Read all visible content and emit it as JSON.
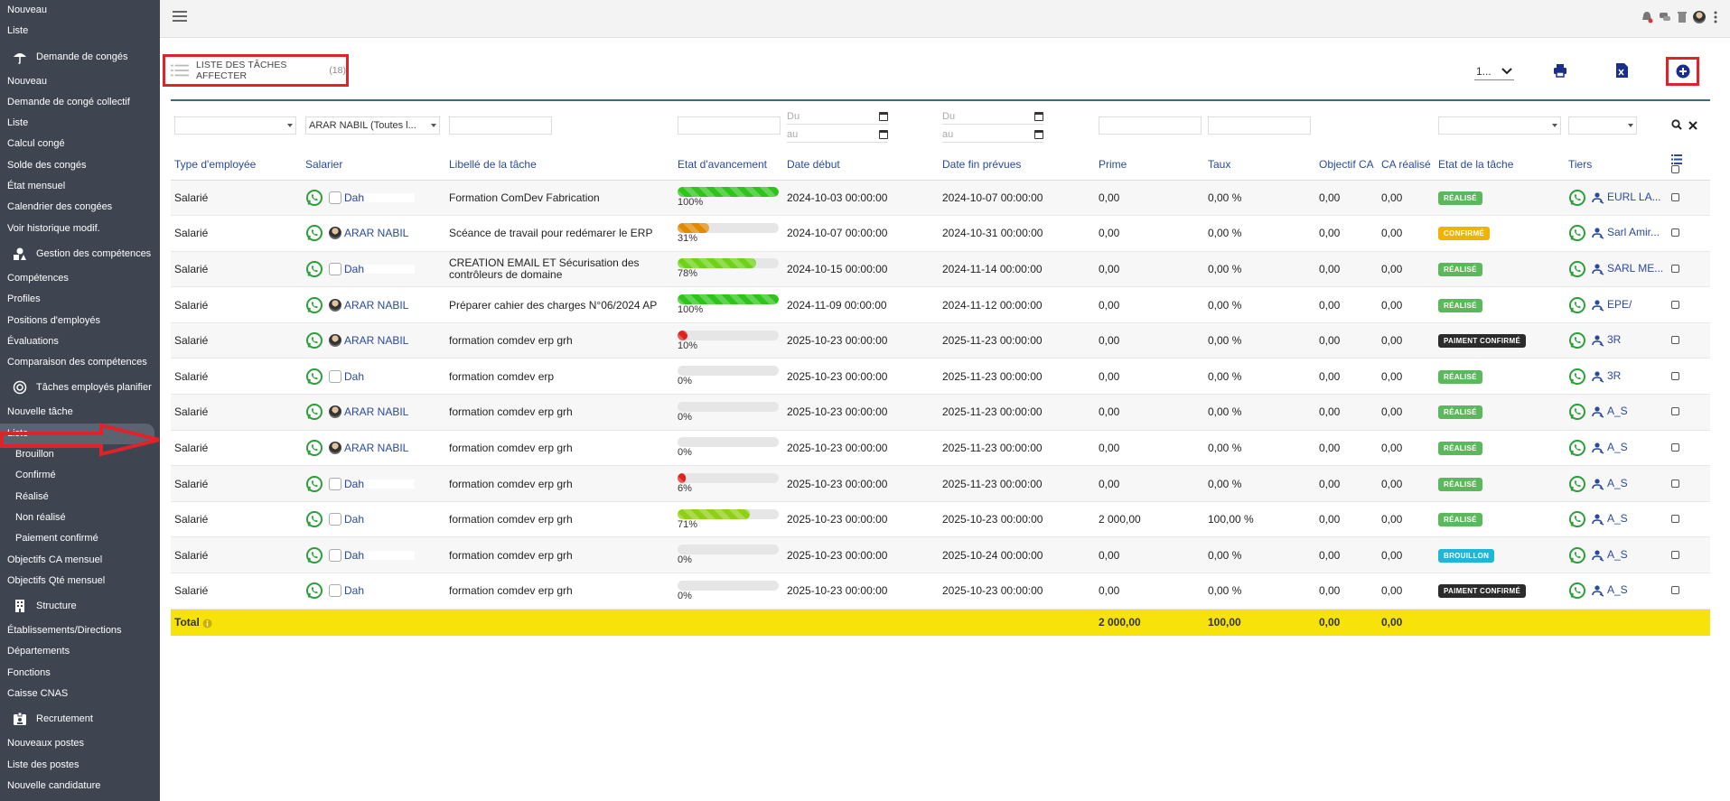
{
  "sidebar": {
    "items": [
      {
        "type": "item",
        "label": "Nouveau"
      },
      {
        "type": "item",
        "label": "Liste"
      },
      {
        "type": "group",
        "label": "Demande de congés",
        "icon": "umbrella-icon"
      },
      {
        "type": "item",
        "label": "Nouveau"
      },
      {
        "type": "item",
        "label": "Demande de congé collectif"
      },
      {
        "type": "item",
        "label": "Liste"
      },
      {
        "type": "item",
        "label": "Calcul congé"
      },
      {
        "type": "item",
        "label": "Solde des congés"
      },
      {
        "type": "item",
        "label": "État mensuel"
      },
      {
        "type": "item",
        "label": "Calendrier des congées"
      },
      {
        "type": "item",
        "label": "Voir historique modif."
      },
      {
        "type": "group",
        "label": "Gestion des compétences",
        "icon": "shapes-icon"
      },
      {
        "type": "item",
        "label": "Compétences"
      },
      {
        "type": "item",
        "label": "Profiles"
      },
      {
        "type": "item",
        "label": "Positions d'employés"
      },
      {
        "type": "item",
        "label": "Évaluations"
      },
      {
        "type": "item",
        "label": "Comparaison des compétences"
      },
      {
        "type": "group",
        "label": "Tâches employés planifier",
        "icon": "target-icon"
      },
      {
        "type": "item",
        "label": "Nouvelle tâche"
      },
      {
        "type": "item",
        "label": "Liste",
        "active": true
      },
      {
        "type": "sub",
        "label": "Brouillon"
      },
      {
        "type": "sub",
        "label": "Confirmé"
      },
      {
        "type": "sub",
        "label": "Réalisé"
      },
      {
        "type": "sub",
        "label": "Non réalisé"
      },
      {
        "type": "sub",
        "label": "Paiement confirmé"
      },
      {
        "type": "item",
        "label": "Objectifs CA mensuel"
      },
      {
        "type": "item",
        "label": "Objectifs Qté mensuel"
      },
      {
        "type": "group",
        "label": "Structure",
        "icon": "building-icon"
      },
      {
        "type": "item",
        "label": "Établissements/Directions"
      },
      {
        "type": "item",
        "label": "Départements"
      },
      {
        "type": "item",
        "label": "Fonctions"
      },
      {
        "type": "item",
        "label": "Caisse CNAS"
      },
      {
        "type": "group",
        "label": "Recrutement",
        "icon": "badge-icon"
      },
      {
        "type": "item",
        "label": "Nouveaux postes"
      },
      {
        "type": "item",
        "label": "Liste des postes"
      },
      {
        "type": "item",
        "label": "Nouvelle candidature"
      }
    ]
  },
  "header": {
    "title": "LISTE DES TÂCHES AFFECTER",
    "count": "(18)",
    "pager_value": "1..."
  },
  "filters": {
    "salarier": "ARAR NABIL (Toutes l...",
    "du": "Du",
    "au": "au"
  },
  "columns": [
    "Type d'employée",
    "Salarier",
    "Libellé de la tâche",
    "Etat d'avancement",
    "Date début",
    "Date fin prévues",
    "Prime",
    "Taux",
    "Objectif CA",
    "CA réalisé",
    "Etat de la tâche",
    "Tiers"
  ],
  "colors": {
    "realise": "#5cb85c",
    "confirme": "#f0b400",
    "paiement": "#2b2b2b",
    "brouillon": "#1fb6d8",
    "progress_full": "#2ec41a",
    "progress_mid": "#e08a00",
    "progress_low": "#e0231a",
    "progress_lime": "#8fd010"
  },
  "rows": [
    {
      "type": "Salarié",
      "employee": "Dah",
      "avatar": "blank",
      "task": "Formation ComDev Fabrication",
      "progress": 100,
      "progress_label": "100%",
      "progress_color": "#2ec41a",
      "start": "2024-10-03 00:00:00",
      "end": "2024-10-07 00:00:00",
      "prime": "0,00",
      "taux": "0,00 %",
      "objectif": "0,00",
      "ca": "0,00",
      "status": "RÉALISÉ",
      "status_color": "#5cb85c",
      "tiers": "EURL LA..."
    },
    {
      "type": "Salarié",
      "employee": "ARAR NABIL",
      "avatar": "photo",
      "task": "Scéance de travail pour redémarer le ERP",
      "progress": 31,
      "progress_label": "31%",
      "progress_color": "#e08a00",
      "start": "2024-10-07 00:00:00",
      "end": "2024-10-31 00:00:00",
      "prime": "0,00",
      "taux": "0,00 %",
      "objectif": "0,00",
      "ca": "0,00",
      "status": "CONFIRMÉ",
      "status_color": "#f0b400",
      "tiers": "Sarl Amir..."
    },
    {
      "type": "Salarié",
      "employee": "Dah",
      "avatar": "blank",
      "task": "CREATION EMAIL ET Sécurisation des",
      "task2": "contrôleurs de domaine",
      "progress": 78,
      "progress_label": "78%",
      "progress_color": "#6fd21a",
      "start": "2024-10-15 00:00:00",
      "end": "2024-11-14 00:00:00",
      "prime": "0,00",
      "taux": "0,00 %",
      "objectif": "0,00",
      "ca": "0,00",
      "status": "RÉALISÉ",
      "status_color": "#5cb85c",
      "tiers": "SARL ME..."
    },
    {
      "type": "Salarié",
      "employee": "ARAR NABIL",
      "avatar": "photo",
      "task": "Préparer cahier des charges N°06/2024 AP",
      "progress": 100,
      "progress_label": "100%",
      "progress_color": "#2ec41a",
      "start": "2024-11-09 00:00:00",
      "end": "2024-11-12 00:00:00",
      "prime": "0,00",
      "taux": "0,00 %",
      "objectif": "0,00",
      "ca": "0,00",
      "status": "RÉALISÉ",
      "status_color": "#5cb85c",
      "tiers": "EPE/"
    },
    {
      "type": "Salarié",
      "employee": "ARAR NABIL",
      "avatar": "photo",
      "task": "formation comdev erp grh",
      "progress": 10,
      "progress_label": "10%",
      "progress_color": "#e0231a",
      "start": "2025-10-23 00:00:00",
      "end": "2025-11-23 00:00:00",
      "prime": "0,00",
      "taux": "0,00 %",
      "objectif": "0,00",
      "ca": "0,00",
      "status": "PAIMENT CONFIRMÉ",
      "status_color": "#2b2b2b",
      "tiers": "3R"
    },
    {
      "type": "Salarié",
      "employee": "Dah",
      "avatar": "blank",
      "task": "formation comdev erp",
      "progress": 0,
      "progress_label": "0%",
      "progress_color": "#e0231a",
      "start": "2025-10-23 00:00:00",
      "end": "2025-11-23 00:00:00",
      "prime": "0,00",
      "taux": "0,00 %",
      "objectif": "0,00",
      "ca": "0,00",
      "status": "RÉALISÉ",
      "status_color": "#5cb85c",
      "tiers": "3R"
    },
    {
      "type": "Salarié",
      "employee": "ARAR NABIL",
      "avatar": "photo",
      "task": "formation comdev erp grh",
      "progress": 0,
      "progress_label": "0%",
      "progress_color": "#e0231a",
      "start": "2025-10-23 00:00:00",
      "end": "2025-11-23 00:00:00",
      "prime": "0,00",
      "taux": "0,00 %",
      "objectif": "0,00",
      "ca": "0,00",
      "status": "RÉALISÉ",
      "status_color": "#5cb85c",
      "tiers": "A_S"
    },
    {
      "type": "Salarié",
      "employee": "ARAR NABIL",
      "avatar": "photo",
      "task": "formation comdev erp grh",
      "progress": 0,
      "progress_label": "0%",
      "progress_color": "#e0231a",
      "start": "2025-10-23 00:00:00",
      "end": "2025-11-23 00:00:00",
      "prime": "0,00",
      "taux": "0,00 %",
      "objectif": "0,00",
      "ca": "0,00",
      "status": "RÉALISÉ",
      "status_color": "#5cb85c",
      "tiers": "A_S"
    },
    {
      "type": "Salarié",
      "employee": "Dah",
      "avatar": "blank",
      "task": "formation comdev erp grh",
      "progress": 6,
      "progress_label": "6%",
      "progress_color": "#e0231a",
      "start": "2025-10-23 00:00:00",
      "end": "2025-11-23 00:00:00",
      "prime": "0,00",
      "taux": "0,00 %",
      "objectif": "0,00",
      "ca": "0,00",
      "status": "RÉALISÉ",
      "status_color": "#5cb85c",
      "tiers": "A_S"
    },
    {
      "type": "Salarié",
      "employee": "Dah",
      "avatar": "blank",
      "task": "formation comdev erp grh",
      "progress": 71,
      "progress_label": "71%",
      "progress_color": "#8fd010",
      "start": "2025-10-23 00:00:00",
      "end": "2025-10-23 00:00:00",
      "prime": "2 000,00",
      "taux": "100,00 %",
      "objectif": "0,00",
      "ca": "0,00",
      "status": "RÉALISÉ",
      "status_color": "#5cb85c",
      "tiers": "A_S"
    },
    {
      "type": "Salarié",
      "employee": "Dah",
      "avatar": "blank",
      "task": "formation comdev erp grh",
      "progress": 0,
      "progress_label": "0%",
      "progress_color": "#e0231a",
      "start": "2025-10-23 00:00:00",
      "end": "2025-10-24 00:00:00",
      "prime": "0,00",
      "taux": "0,00 %",
      "objectif": "0,00",
      "ca": "0,00",
      "status": "BROUILLON",
      "status_color": "#1fb6d8",
      "tiers": "A_S"
    },
    {
      "type": "Salarié",
      "employee": "Dah",
      "avatar": "blank",
      "task": "formation comdev erp grh",
      "progress": 0,
      "progress_label": "0%",
      "progress_color": "#e0231a",
      "start": "2025-10-23 00:00:00",
      "end": "2025-10-23 00:00:00",
      "prime": "0,00",
      "taux": "0,00 %",
      "objectif": "0,00",
      "ca": "0,00",
      "status": "PAIMENT CONFIRMÉ",
      "status_color": "#2b2b2b",
      "tiers": "A_S"
    }
  ],
  "total": {
    "label": "Total",
    "prime": "2 000,00",
    "taux": "100,00",
    "objectif": "0,00",
    "ca": "0,00"
  }
}
